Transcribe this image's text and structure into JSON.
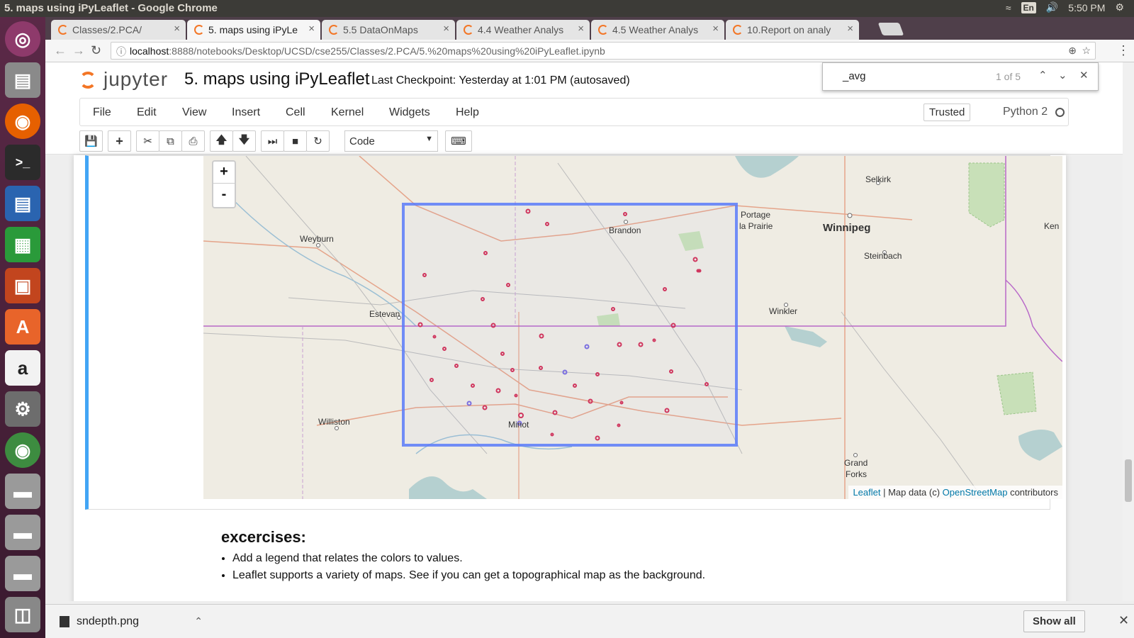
{
  "system": {
    "window_title": "5. maps using iPyLeaflet - Google Chrome",
    "lang": "En",
    "time": "5:50 PM"
  },
  "tabs": [
    {
      "label": "Classes/2.PCA/"
    },
    {
      "label": "5. maps using iPyLe"
    },
    {
      "label": "5.5 DataOnMaps"
    },
    {
      "label": "4.4 Weather Analys"
    },
    {
      "label": "4.5 Weather Analys"
    },
    {
      "label": "10.Report on analy"
    }
  ],
  "address": {
    "host": "localhost",
    "path": ":8888/notebooks/Desktop/UCSD/cse255/Classes/2.PCA/5.%20maps%20using%20iPyLeaflet.ipynb"
  },
  "jupyter": {
    "logo": "jupyter",
    "notebook_title": "5. maps using iPyLeaflet",
    "checkpoint": "Last Checkpoint: Yesterday at 1:01 PM (autosaved)",
    "menus": [
      "File",
      "Edit",
      "View",
      "Insert",
      "Cell",
      "Kernel",
      "Widgets",
      "Help"
    ],
    "trusted": "Trusted",
    "kernel": "Python 2",
    "cell_type": "Code"
  },
  "find": {
    "query": "_avg",
    "count": "1 of 5"
  },
  "map": {
    "places": {
      "selkirk": "Selkirk",
      "portage": "Portage",
      "la_prairie": "la Prairie",
      "winnipeg": "Winnipeg",
      "kenora": "Ken",
      "brandon": "Brandon",
      "weyburn": "Weyburn",
      "steinbach": "Steinbach",
      "estevan": "Estevan",
      "winkler": "Winkler",
      "williston": "Williston",
      "minot": "Minot",
      "grand": "Grand",
      "forks": "Forks"
    },
    "zoom_in": "+",
    "zoom_out": "-",
    "attribution": {
      "leaflet": "Leaflet",
      "mid": " | Map data (c) ",
      "osm": "OpenStreetMap",
      "end": " contributors"
    }
  },
  "exercises": {
    "title": "excercises:",
    "items": [
      "Add a legend that relates the colors to values.",
      "Leaflet supports a variety of maps. See if you can get a topographical map as the background."
    ]
  },
  "downloads": {
    "file": "sndepth.png",
    "show_all": "Show all"
  },
  "colors": {
    "accent": "#f37626",
    "rect": "#5b7cfa",
    "markers": "#d0365e",
    "border": "#b868c8"
  }
}
